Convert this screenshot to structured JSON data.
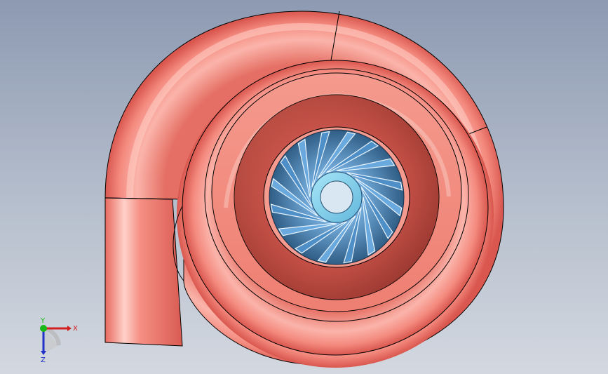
{
  "viewport": {
    "background_top": "#8d9ab2",
    "background_bottom": "#d3d8e0"
  },
  "model": {
    "casing_color": "#f27f72",
    "impeller_color": "#5f9fd6",
    "hub_color": "#8fd7ef"
  },
  "triad": {
    "x_label": "X",
    "y_label": "Y",
    "z_label": "Z",
    "x_color": "#d21f1f",
    "y_color": "#18b818",
    "z_color": "#2232c8"
  }
}
